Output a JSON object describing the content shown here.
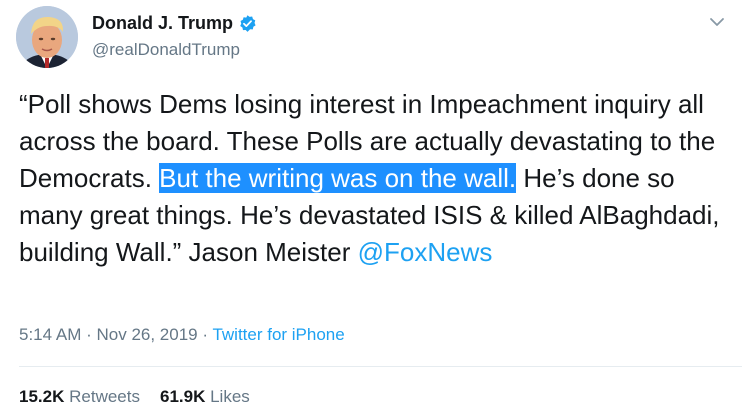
{
  "user": {
    "display_name": "Donald J. Trump",
    "handle": "@realDonaldTrump",
    "verified": true
  },
  "tweet": {
    "text_before": "“Poll shows Dems losing interest in Impeachment inquiry all across the board. These Polls are actually devastating to the Democrats. ",
    "text_highlighted": "But the writing was on the wall.",
    "text_after": " He’s done so many great things. He’s devastated ISIS & killed AlBaghdadi, building Wall.” Jason Meister ",
    "mention": "@FoxNews"
  },
  "meta": {
    "time": "5:14 AM",
    "separator1": " · ",
    "date": "Nov 26, 2019",
    "separator2": " · ",
    "source": "Twitter for iPhone"
  },
  "stats": {
    "retweets_count": "15.2K",
    "retweets_label": "Retweets",
    "likes_count": "61.9K",
    "likes_label": "Likes"
  },
  "icons": {
    "verified": "verified-badge-icon",
    "menu": "chevron-down-icon"
  },
  "colors": {
    "accent": "#1da1f2",
    "highlight": "#1e90ff",
    "muted": "#657786",
    "text": "#14171a"
  }
}
